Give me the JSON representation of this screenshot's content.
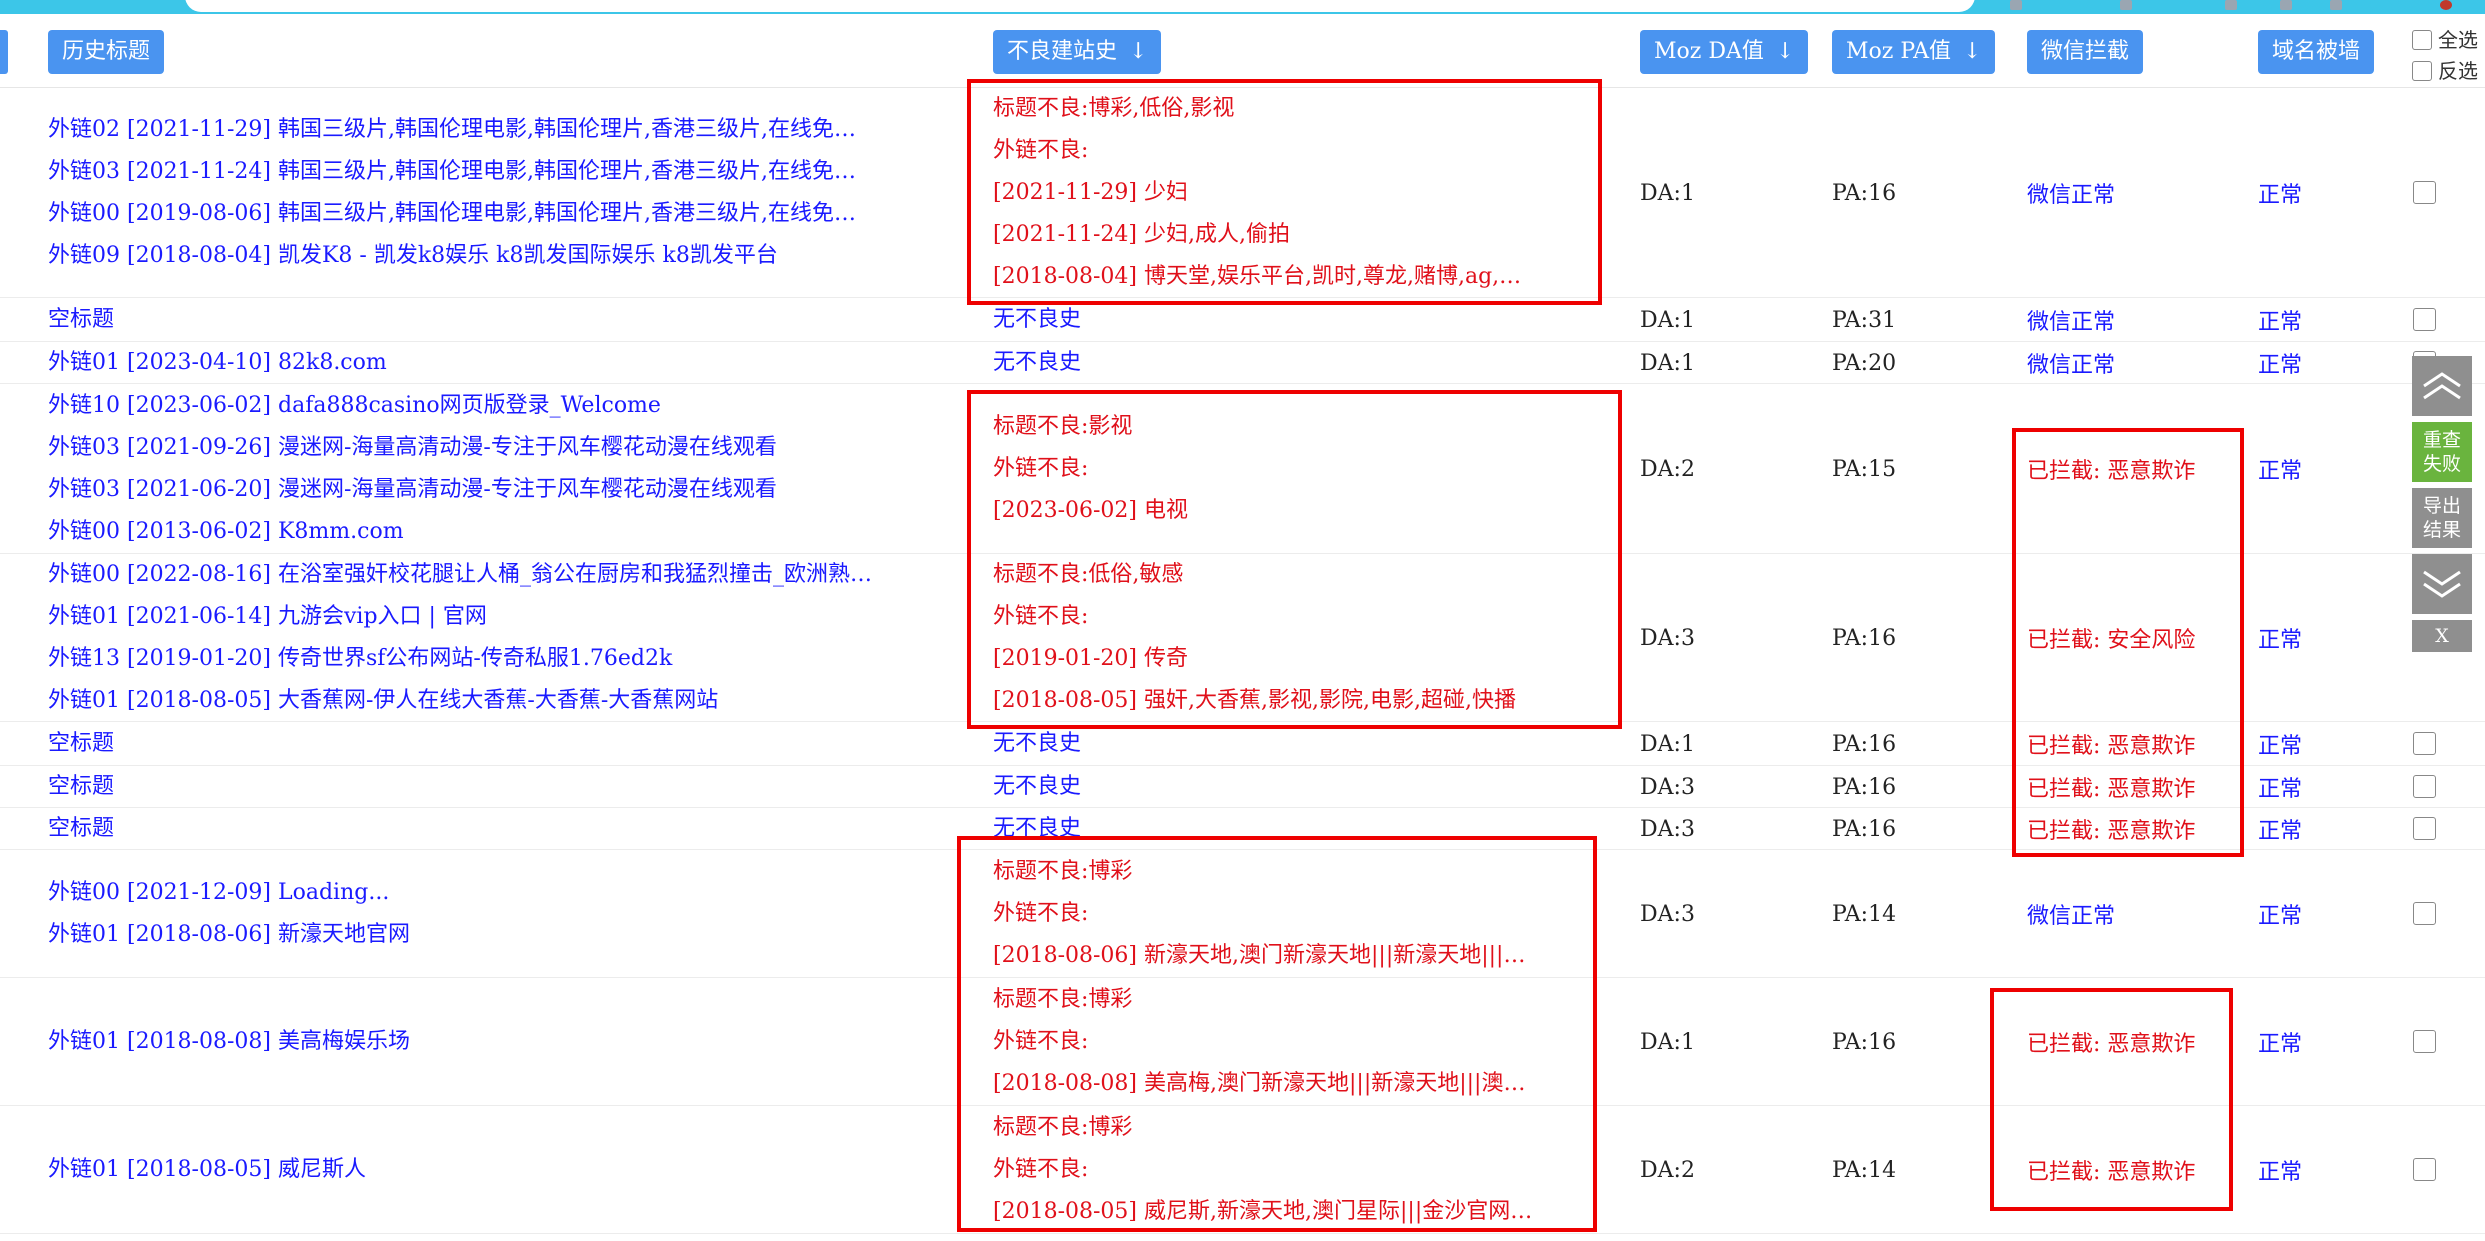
{
  "header": {
    "history_title": "历史标题",
    "bad_history": "不良建站史",
    "moz_da": "Moz DA值",
    "moz_pa": "Moz PA值",
    "wechat_block": "微信拦截",
    "domain_wall": "域名被墙",
    "sort_arrow": "↓",
    "select_all": "全选",
    "invert_select": "反选"
  },
  "rows": [
    {
      "titles": [
        "外链02 [2021-11-29] 韩国三级片,韩国伦理电影,韩国伦理片,香港三级片,在线免…",
        "外链03 [2021-11-24] 韩国三级片,韩国伦理电影,韩国伦理片,香港三级片,在线免…",
        "外链00 [2019-08-06] 韩国三级片,韩国伦理电影,韩国伦理片,香港三级片,在线免…",
        "外链09 [2018-08-04] 凯发K8 - 凯发k8娱乐 k8凯发国际娱乐 k8凯发平台"
      ],
      "bad": [
        "标题不良:博彩,低俗,影视",
        "外链不良:",
        "[2021-11-29] 少妇",
        "[2021-11-24] 少妇,成人,偷拍",
        "[2018-08-04] 博天堂,娱乐平台,凯时,尊龙,赌博,ag,…"
      ],
      "da": "DA:1",
      "pa": "PA:16",
      "wx": "微信正常",
      "dom": "正常"
    },
    {
      "titles": [
        "空标题"
      ],
      "bad": [
        "无不良史"
      ],
      "da": "DA:1",
      "pa": "PA:31",
      "wx": "微信正常",
      "dom": "正常"
    },
    {
      "titles": [
        "外链01 [2023-04-10] 82k8.com"
      ],
      "bad": [
        "无不良史"
      ],
      "da": "DA:1",
      "pa": "PA:20",
      "wx": "微信正常",
      "dom": "正常"
    },
    {
      "titles": [
        "外链10 [2023-06-02] dafa888casino网页版登录_Welcome",
        "外链03 [2021-09-26] 漫迷网-海量高清动漫-专注于风车樱花动漫在线观看",
        "外链03 [2021-06-20] 漫迷网-海量高清动漫-专注于风车樱花动漫在线观看",
        "外链00 [2013-06-02] K8mm.com"
      ],
      "bad": [
        "标题不良:影视",
        "外链不良:",
        "[2023-06-02] 电视"
      ],
      "da": "DA:2",
      "pa": "PA:15",
      "wx": "已拦截: 恶意欺诈",
      "dom": "正常"
    },
    {
      "titles": [
        "外链00 [2022-08-16] 在浴室强奸校花腿让人桶_翁公在厨房和我猛烈撞击_欧洲熟…",
        "外链01 [2021-06-14] 九游会vip入口 | 官网",
        "外链13 [2019-01-20] 传奇世界sf公布网站-传奇私服1.76ed2k",
        "外链01 [2018-08-05] 大香蕉网-伊人在线大香蕉-大香蕉-大香蕉网站"
      ],
      "bad": [
        "标题不良:低俗,敏感",
        "外链不良:",
        "[2019-01-20] 传奇",
        "[2018-08-05] 强奸,大香蕉,影视,影院,电影,超碰,快播"
      ],
      "da": "DA:3",
      "pa": "PA:16",
      "wx": "已拦截: 安全风险",
      "dom": "正常"
    },
    {
      "titles": [
        "空标题"
      ],
      "bad": [
        "无不良史"
      ],
      "da": "DA:1",
      "pa": "PA:16",
      "wx": "已拦截: 恶意欺诈",
      "dom": "正常"
    },
    {
      "titles": [
        "空标题"
      ],
      "bad": [
        "无不良史"
      ],
      "da": "DA:3",
      "pa": "PA:16",
      "wx": "已拦截: 恶意欺诈",
      "dom": "正常"
    },
    {
      "titles": [
        "空标题"
      ],
      "bad": [
        "无不良史"
      ],
      "da": "DA:3",
      "pa": "PA:16",
      "wx": "已拦截: 恶意欺诈",
      "dom": "正常"
    },
    {
      "titles": [
        "外链00 [2021-12-09] Loading...",
        "外链01 [2018-08-06] 新濠天地官网"
      ],
      "bad": [
        "标题不良:博彩",
        "外链不良:",
        "[2018-08-06] 新濠天地,澳门新濠天地|||新濠天地|||…"
      ],
      "da": "DA:3",
      "pa": "PA:14",
      "wx": "微信正常",
      "dom": "正常"
    },
    {
      "titles": [
        "外链01 [2018-08-08] 美高梅娱乐场"
      ],
      "bad": [
        "标题不良:博彩",
        "外链不良:",
        "[2018-08-08] 美高梅,澳门新濠天地|||新濠天地|||澳…"
      ],
      "da": "DA:1",
      "pa": "PA:16",
      "wx": "已拦截: 恶意欺诈",
      "dom": "正常"
    },
    {
      "titles": [
        "外链01 [2018-08-05] 威尼斯人"
      ],
      "bad": [
        "标题不良:博彩",
        "外链不良:",
        "[2018-08-05] 威尼斯,新濠天地,澳门星际|||金沙官网…"
      ],
      "da": "DA:2",
      "pa": "PA:14",
      "wx": "已拦截: 恶意欺诈",
      "dom": "正常"
    }
  ],
  "side_panel": {
    "recheck_failed": "重查失败",
    "export_results": "导出结果",
    "close": "X"
  },
  "colors": {
    "button_blue": "#4a94f0",
    "link_blue": "#1a1aff",
    "alert_red": "#e0101a",
    "highlight_box": "#ee0000",
    "top_bar": "#3cc6e8"
  }
}
